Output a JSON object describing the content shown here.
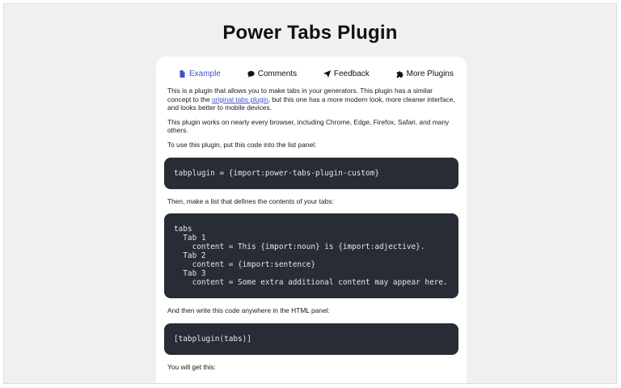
{
  "page": {
    "title": "Power Tabs Plugin"
  },
  "tabs": [
    {
      "label": "Example",
      "icon": "file-icon",
      "active": true
    },
    {
      "label": "Comments",
      "icon": "comment-icon",
      "active": false
    },
    {
      "label": "Feedback",
      "icon": "paper-plane-icon",
      "active": false
    },
    {
      "label": "More Plugins",
      "icon": "puzzle-icon",
      "active": false
    }
  ],
  "content": {
    "intro_before_link": "This is a plugin that allows you to make tabs in your generators. This plugin has a similar concept to the ",
    "intro_link": "original tabs plugin",
    "intro_after_link": ", but this one has a more modern look, more cleaner interface, and looks better to mobile devices.",
    "browsers": "This plugin works on nearly every browser, including Chrome, Edge, Firefox, Safari, and many others.",
    "step1": "To use this plugin, put this code into the list panel:",
    "code1": "tabplugin = {import:power-tabs-plugin-custom}",
    "step2": "Then, make a list that defines the contents of your tabs:",
    "code2": "tabs\n  Tab 1\n    content = This {import:noun} is {import:adjective}.\n  Tab 2\n    content = {import:sentence}\n  Tab 3\n    content = Some extra additional content may appear here.",
    "step3": "And then write this code anywhere in the HTML panel:",
    "code3": "[tabplugin(tabs)]",
    "step4": "You will get this:"
  },
  "colors": {
    "background": "#f0f0f0",
    "card": "#ffffff",
    "accent": "#3f4fd8",
    "code_bg": "#282c34"
  }
}
